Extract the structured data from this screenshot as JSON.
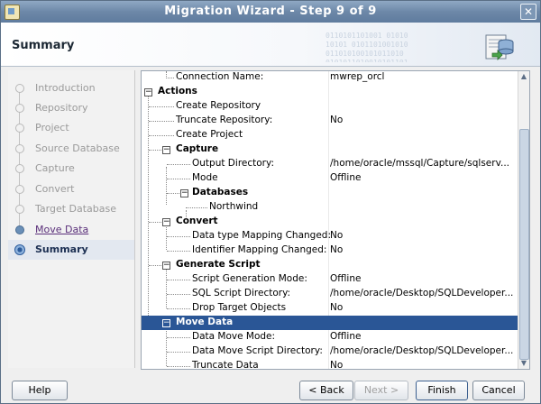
{
  "window": {
    "title": "Migration Wizard - Step 9 of 9"
  },
  "header": {
    "title": "Summary",
    "binary": "0110101101001 01010\n10101 0101101001010\n011010100101011010\n0101011010010101101"
  },
  "nav": {
    "items": [
      {
        "label": "Introduction",
        "state": "pending"
      },
      {
        "label": "Repository",
        "state": "pending"
      },
      {
        "label": "Project",
        "state": "pending"
      },
      {
        "label": "Source Database",
        "state": "pending"
      },
      {
        "label": "Capture",
        "state": "pending"
      },
      {
        "label": "Convert",
        "state": "pending"
      },
      {
        "label": "Target Database",
        "state": "pending"
      },
      {
        "label": "Move Data",
        "state": "done"
      },
      {
        "label": "Summary",
        "state": "current"
      }
    ]
  },
  "tree": {
    "rows": [
      {
        "name": "Connection Name:",
        "value": "mwrep_orcl"
      },
      {
        "name": "Actions",
        "value": ""
      },
      {
        "name": "Create Repository",
        "value": ""
      },
      {
        "name": "Truncate Repository:",
        "value": "No"
      },
      {
        "name": "Create Project",
        "value": ""
      },
      {
        "name": "Capture",
        "value": ""
      },
      {
        "name": "Output Directory:",
        "value": "/home/oracle/mssql/Capture/sqlserv..."
      },
      {
        "name": "Mode",
        "value": "Offline"
      },
      {
        "name": "Databases",
        "value": ""
      },
      {
        "name": "Northwind",
        "value": ""
      },
      {
        "name": "Convert",
        "value": ""
      },
      {
        "name": "Data type Mapping Changed:",
        "value": "No"
      },
      {
        "name": "Identifier Mapping Changed:",
        "value": "No"
      },
      {
        "name": "Generate Script",
        "value": ""
      },
      {
        "name": "Script Generation Mode:",
        "value": "Offline"
      },
      {
        "name": "SQL Script Directory:",
        "value": "/home/oracle/Desktop/SQLDeveloper..."
      },
      {
        "name": "Drop Target Objects",
        "value": "No"
      },
      {
        "name": "Move Data",
        "value": ""
      },
      {
        "name": "Data Move Mode:",
        "value": "Offline"
      },
      {
        "name": "Data Move Script Directory:",
        "value": "/home/oracle/Desktop/SQLDeveloper..."
      },
      {
        "name": "Truncate Data",
        "value": "No"
      }
    ]
  },
  "buttons": {
    "help": "Help",
    "back": "< Back",
    "next": "Next >",
    "finish": "Finish",
    "cancel": "Cancel"
  },
  "colors": {
    "selection": "#2a5696",
    "titlebar": "#6d88a8"
  }
}
